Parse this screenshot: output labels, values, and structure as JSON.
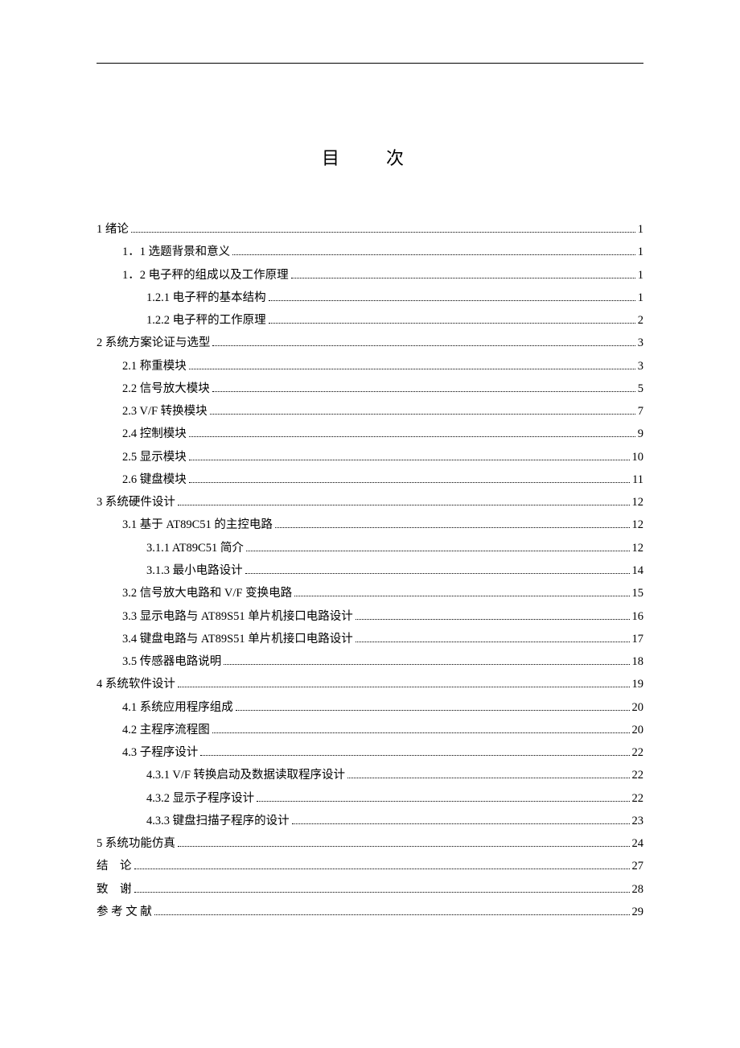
{
  "title": "目　次",
  "toc": [
    {
      "level": 0,
      "num": "1",
      "text": "绪论",
      "page": "1"
    },
    {
      "level": 1,
      "num": "1．1",
      "text": "选题背景和意义",
      "page": "1"
    },
    {
      "level": 1,
      "num": "1．2",
      "text": "电子秤的组成以及工作原理",
      "page": "1"
    },
    {
      "level": 2,
      "num": "1.2.1",
      "text": "电子秤的基本结构",
      "page": "1"
    },
    {
      "level": 2,
      "num": "1.2.2",
      "text": "电子秤的工作原理",
      "page": "2"
    },
    {
      "level": 0,
      "num": "2",
      "text": "系统方案论证与选型",
      "page": "3"
    },
    {
      "level": 1,
      "num": "2.1",
      "text": "称重模块",
      "page": "3"
    },
    {
      "level": 1,
      "num": "2.2",
      "text": "信号放大模块",
      "page": "5"
    },
    {
      "level": 1,
      "num": "2.3",
      "text": "V/F 转换模块",
      "page": "7"
    },
    {
      "level": 1,
      "num": "2.4",
      "text": "控制模块",
      "page": "9"
    },
    {
      "level": 1,
      "num": "2.5",
      "text": "显示模块",
      "page": "10"
    },
    {
      "level": 1,
      "num": "2.6",
      "text": "键盘模块",
      "page": "11"
    },
    {
      "level": 0,
      "num": "3",
      "text": "系统硬件设计",
      "page": "12"
    },
    {
      "level": 1,
      "num": "3.1",
      "text": "基于 AT89C51 的主控电路",
      "page": "12"
    },
    {
      "level": 2,
      "num": "3.1.1",
      "text": "AT89C51 简介",
      "page": "12"
    },
    {
      "level": 2,
      "num": "3.1.3",
      "text": "最小电路设计",
      "page": "14"
    },
    {
      "level": 1,
      "num": "3.2",
      "text": "信号放大电路和 V/F 变换电路",
      "page": "15"
    },
    {
      "level": 1,
      "num": "3.3",
      "text": "显示电路与 AT89S51 单片机接口电路设计",
      "page": "16"
    },
    {
      "level": 1,
      "num": "3.4",
      "text": "键盘电路与 AT89S51 单片机接口电路设计",
      "page": "17"
    },
    {
      "level": 1,
      "num": "3.5",
      "text": "传感器电路说明",
      "page": "18"
    },
    {
      "level": 0,
      "num": "4",
      "text": "系统软件设计",
      "page": "19"
    },
    {
      "level": 1,
      "num": "4.1",
      "text": "系统应用程序组成",
      "page": "20"
    },
    {
      "level": 1,
      "num": "4.2",
      "text": "主程序流程图",
      "page": "20"
    },
    {
      "level": 1,
      "num": "4.3",
      "text": "子程序设计",
      "page": "22"
    },
    {
      "level": 2,
      "num": "4.3.1",
      "text": "V/F 转换启动及数据读取程序设计",
      "page": "22"
    },
    {
      "level": 2,
      "num": "4.3.2",
      "text": "显示子程序设计",
      "page": "22"
    },
    {
      "level": 2,
      "num": "4.3.3",
      "text": "键盘扫描子程序的设计",
      "page": "23"
    },
    {
      "level": 0,
      "num": "5",
      "text": "系统功能仿真",
      "page": "24"
    },
    {
      "level": 0,
      "num": "结",
      "text": "论",
      "page": "27",
      "spaced": true
    },
    {
      "level": 0,
      "num": "致",
      "text": "谢",
      "page": "28",
      "spaced": true
    },
    {
      "level": 0,
      "num": "",
      "text": "参 考 文 献",
      "page": "29"
    }
  ]
}
